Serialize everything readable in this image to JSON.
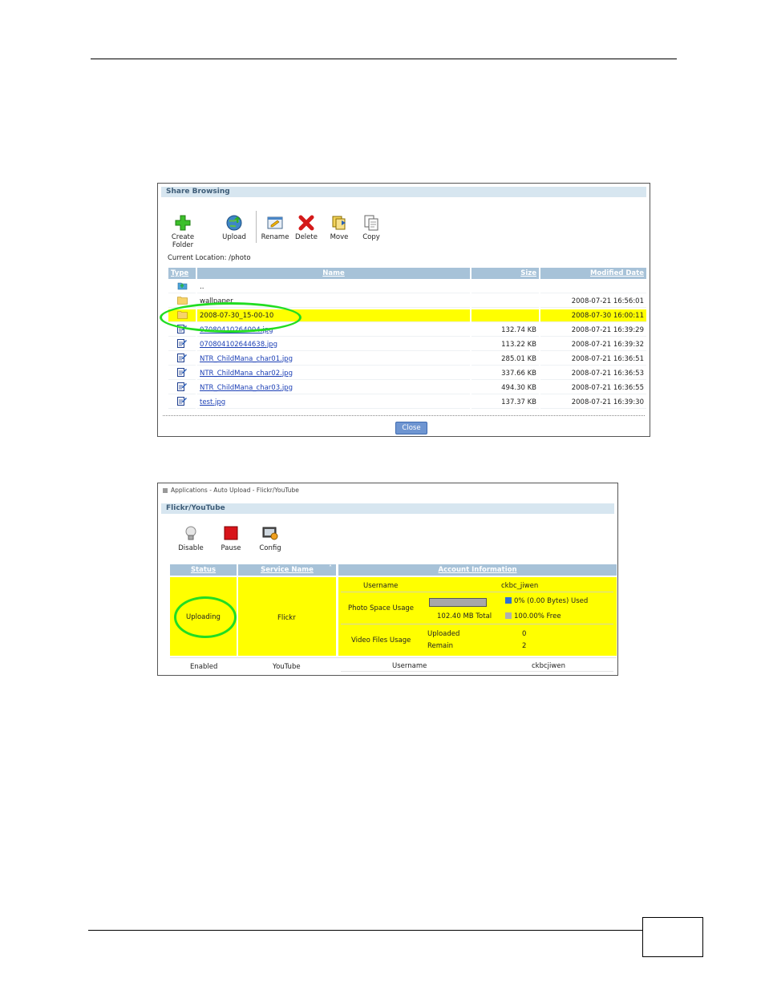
{
  "share": {
    "title": "Share Browsing",
    "toolbar": {
      "create_folder": "Create Folder",
      "upload": "Upload",
      "rename": "Rename",
      "delete": "Delete",
      "move": "Move",
      "copy": "Copy"
    },
    "current_location": "Current Location: /photo",
    "columns": {
      "type": "Type",
      "name": "Name",
      "size": "Size",
      "modified": "Modified Date"
    },
    "rows": [
      {
        "icon": "parent-folder-icon",
        "name": "..",
        "size": "",
        "modified": ""
      },
      {
        "icon": "folder-icon",
        "name": "wallpaper",
        "size": "",
        "modified": "2008-07-21 16:56:01"
      },
      {
        "icon": "folder-icon",
        "name": "2008-07-30_15-00-10",
        "size": "",
        "modified": "2008-07-30 16:00:11"
      },
      {
        "icon": "file-icon",
        "name": "07080410264004.jpg",
        "size": "132.74 KB",
        "modified": "2008-07-21 16:39:29"
      },
      {
        "icon": "file-icon",
        "name": "070804102644638.jpg",
        "size": "113.22 KB",
        "modified": "2008-07-21 16:39:32"
      },
      {
        "icon": "file-icon",
        "name": "NTR_ChildMana_char01.jpg",
        "size": "285.01 KB",
        "modified": "2008-07-21 16:36:51"
      },
      {
        "icon": "file-icon",
        "name": "NTR_ChildMana_char02.jpg",
        "size": "337.66 KB",
        "modified": "2008-07-21 16:36:53"
      },
      {
        "icon": "file-icon",
        "name": "NTR_ChildMana_char03.jpg",
        "size": "494.30 KB",
        "modified": "2008-07-21 16:36:55"
      },
      {
        "icon": "file-icon",
        "name": "test.jpg",
        "size": "137.37 KB",
        "modified": "2008-07-21 16:39:30"
      }
    ],
    "close_label": "Close"
  },
  "flickr": {
    "breadcrumb": "Applications - Auto Upload - Flickr/YouTube",
    "title": "Flickr/YouTube",
    "toolbar": {
      "disable": "Disable",
      "pause": "Pause",
      "config": "Config"
    },
    "columns": {
      "status": "Status",
      "service": "Service Name",
      "account": "Account Information"
    },
    "flickr_row": {
      "status": "Uploading",
      "service": "Flickr",
      "username_label": "Username",
      "username": "ckbc_jiwen",
      "photo_label": "Photo Space Usage",
      "used_text": "0% (0.00 Bytes) Used",
      "total_text": "102.40 MB Total",
      "free_text": "100.00% Free",
      "used_fraction": 0.0,
      "video_label": "Video Files Usage",
      "uploaded_label": "Uploaded",
      "uploaded": "0",
      "remain_label": "Remain",
      "remain": "2"
    },
    "youtube_row": {
      "status": "Enabled",
      "service": "YouTube",
      "username_label": "Username",
      "username": "ckbcjiwen"
    }
  }
}
